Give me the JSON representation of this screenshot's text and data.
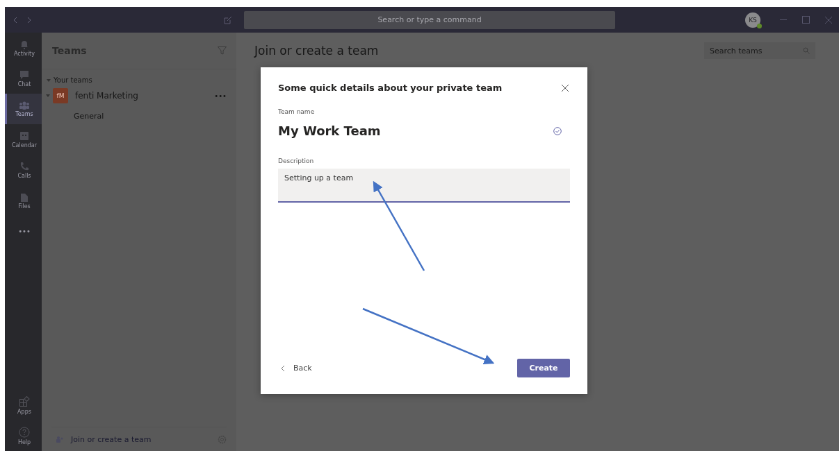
{
  "titlebar": {
    "search_placeholder": "Search or type a command",
    "avatar": "KS"
  },
  "rail": [
    {
      "kind": "activity",
      "label": "Activity",
      "selected": false
    },
    {
      "kind": "chat",
      "label": "Chat",
      "selected": false
    },
    {
      "kind": "teams",
      "label": "Teams",
      "selected": true
    },
    {
      "kind": "calendar",
      "label": "Calendar",
      "selected": false
    },
    {
      "kind": "calls",
      "label": "Calls",
      "selected": false
    },
    {
      "kind": "files",
      "label": "Files",
      "selected": false
    },
    {
      "kind": "more",
      "label": "•••",
      "selected": false
    }
  ],
  "rail_bottom": [
    {
      "kind": "apps",
      "label": "Apps",
      "selected": false
    },
    {
      "kind": "help",
      "label": "Help",
      "selected": false
    }
  ],
  "teams_panel": {
    "title": "Teams",
    "section": "Your teams",
    "teams": [
      {
        "initials": "fM",
        "name": "fenti Marketing",
        "more": "•••",
        "expanded": true,
        "channels": [
          "General"
        ]
      }
    ],
    "footer": "Join or create a team"
  },
  "main": {
    "title": "Join or create a team",
    "search_placeholder": "Search teams"
  },
  "dialog": {
    "title": "Some quick details about your private team",
    "name_label": "Team name",
    "name_value": "My Work Team",
    "name_valid": true,
    "description_label": "Description",
    "description_value": "Setting up a team",
    "back": "Back",
    "create": "Create"
  }
}
